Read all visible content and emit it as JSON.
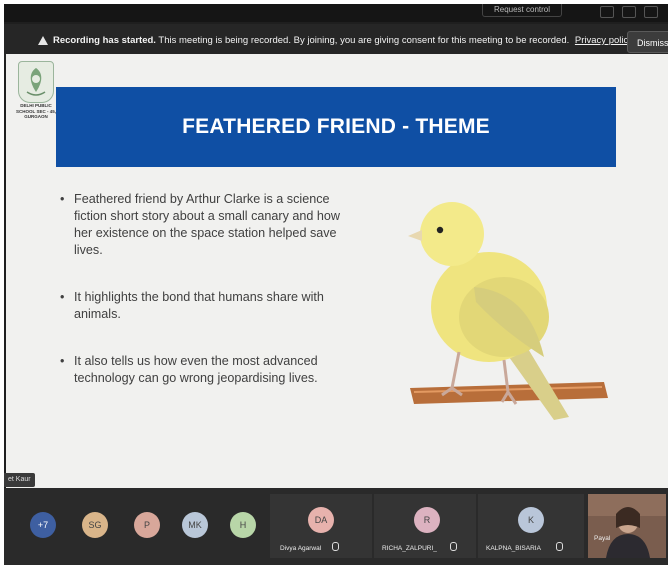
{
  "top_bar": {
    "request_label": "Request control"
  },
  "banner": {
    "title": "Recording has started.",
    "message": "This meeting is being recorded. By joining, you are giving consent for this meeting to be recorded.",
    "link": "Privacy policy",
    "dismiss": "Dismiss"
  },
  "slide": {
    "logo_caption": "DELHI PUBLIC SCHOOL SEC - 45, GURGAON",
    "title": "FEATHERED FRIEND - THEME",
    "bullets": [
      "Feathered friend by Arthur Clarke is a science fiction short story about a small canary and how her existence on the space station helped save lives.",
      "It highlights the bond that humans share with animals.",
      "It also tells us how even the most advanced technology can go wrong jeopardising lives."
    ]
  },
  "presenter_tag": "et Kaur",
  "participants": {
    "more_count": "+7",
    "avatars": [
      {
        "initials": "SG",
        "color": "#d9b58a"
      },
      {
        "initials": "P",
        "color": "#d8a79a"
      },
      {
        "initials": "MK",
        "color": "#b9c7d8"
      },
      {
        "initials": "H",
        "color": "#b8d6a8"
      }
    ],
    "tiles": [
      {
        "initials": "DA",
        "name": "Divya Agarwal",
        "color": "#e7b2ad"
      },
      {
        "initials": "R",
        "name": "RICHA_ZALPURI_",
        "color": "#dcb2c0"
      },
      {
        "initials": "K",
        "name": "KALPNA_BISARIA",
        "color": "#b9c6d9"
      }
    ],
    "video_name": "Payal"
  },
  "colors": {
    "title_bar": "#0f4fa4",
    "more_badge": "#3e5fa1"
  }
}
